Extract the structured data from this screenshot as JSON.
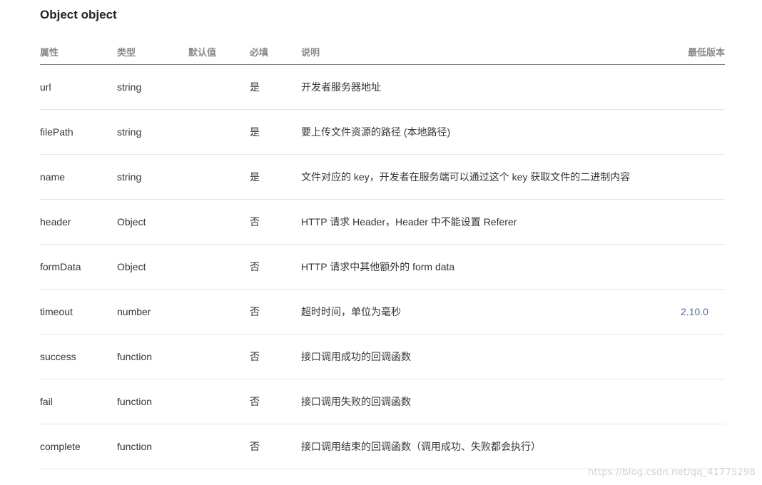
{
  "title": "Object object",
  "columns": {
    "name": "属性",
    "type": "类型",
    "default": "默认值",
    "required": "必填",
    "description": "说明",
    "version": "最低版本"
  },
  "rows": [
    {
      "name": "url",
      "type": "string",
      "default": "",
      "required": "是",
      "description": "开发者服务器地址",
      "version": ""
    },
    {
      "name": "filePath",
      "type": "string",
      "default": "",
      "required": "是",
      "description": "要上传文件资源的路径 (本地路径)",
      "version": ""
    },
    {
      "name": "name",
      "type": "string",
      "default": "",
      "required": "是",
      "description": "文件对应的 key，开发者在服务端可以通过这个 key 获取文件的二进制内容",
      "version": ""
    },
    {
      "name": "header",
      "type": "Object",
      "default": "",
      "required": "否",
      "description": "HTTP 请求 Header，Header 中不能设置 Referer",
      "version": ""
    },
    {
      "name": "formData",
      "type": "Object",
      "default": "",
      "required": "否",
      "description": "HTTP 请求中其他额外的 form data",
      "version": ""
    },
    {
      "name": "timeout",
      "type": "number",
      "default": "",
      "required": "否",
      "description": "超时时间，单位为毫秒",
      "version": "2.10.0"
    },
    {
      "name": "success",
      "type": "function",
      "default": "",
      "required": "否",
      "description": "接口调用成功的回调函数",
      "version": ""
    },
    {
      "name": "fail",
      "type": "function",
      "default": "",
      "required": "否",
      "description": "接口调用失败的回调函数",
      "version": ""
    },
    {
      "name": "complete",
      "type": "function",
      "default": "",
      "required": "否",
      "description": "接口调用结束的回调函数（调用成功、失败都会执行）",
      "version": ""
    }
  ],
  "watermark": "https://blog.csdn.net/qq_41775298",
  "colors": {
    "text": "#353535",
    "header_text": "#888888",
    "version_link": "#576b95",
    "row_divider": "#e6e6e6",
    "header_divider": "#7c7c7c"
  }
}
